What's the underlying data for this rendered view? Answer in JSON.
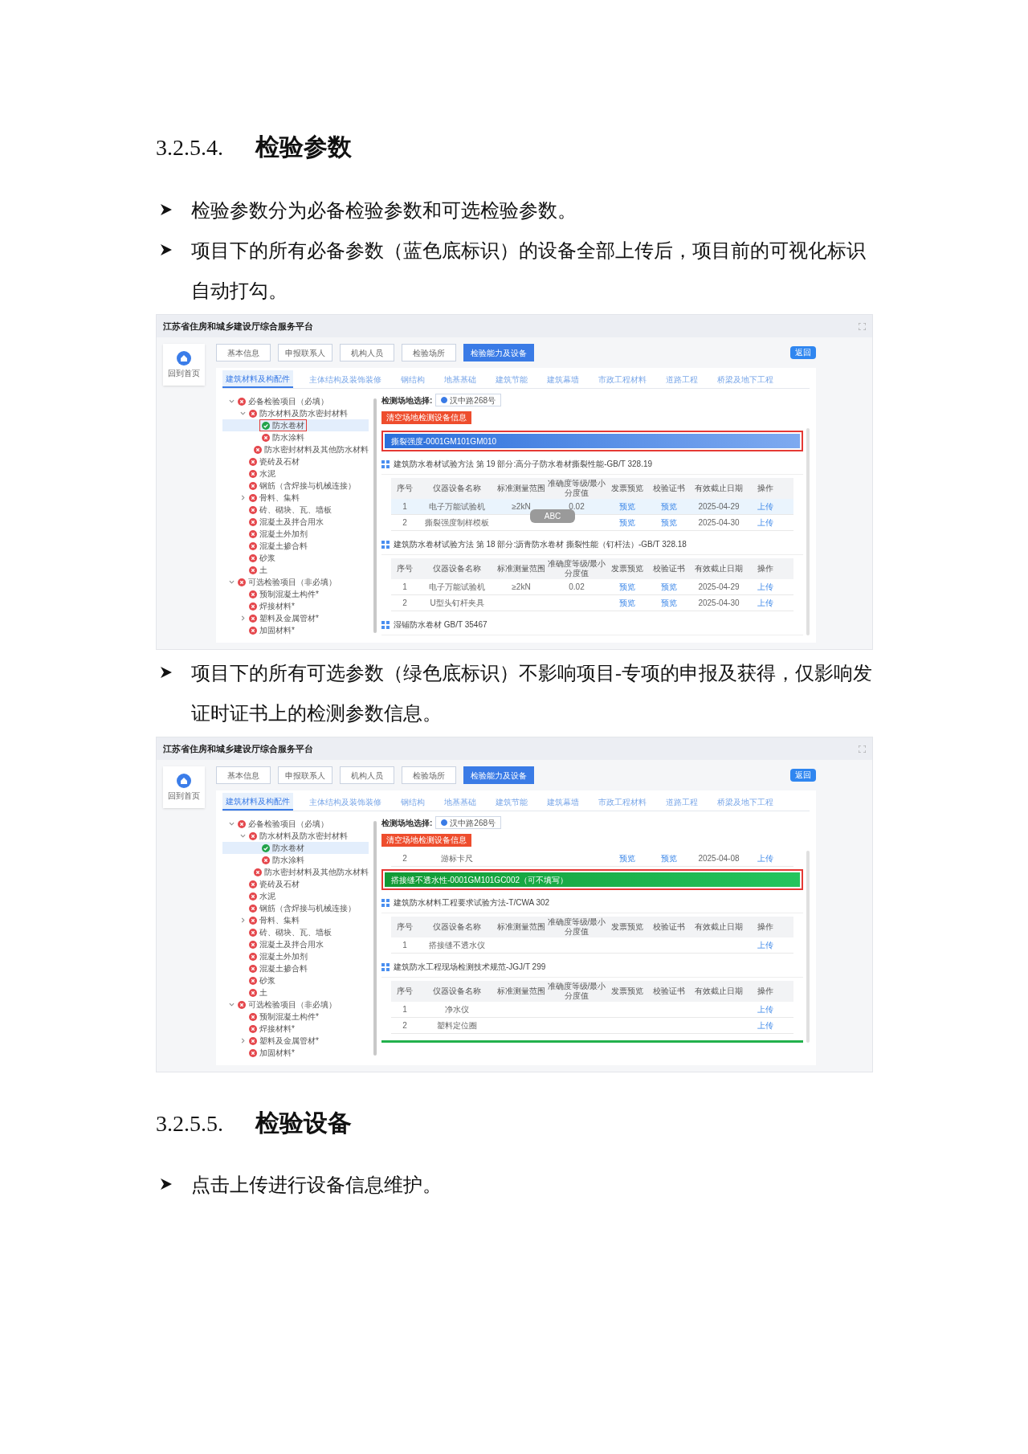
{
  "sections": [
    {
      "kind": "heading",
      "number": "3.2.5.4.",
      "title": "检验参数"
    },
    {
      "kind": "bullet",
      "text": "检验参数分为必备检验参数和可选检验参数。"
    },
    {
      "kind": "bullet",
      "text": "项目下的所有必备参数（蓝色底标识）的设备全部上传后，项目前的可视化标识自动打勾。"
    },
    {
      "kind": "screenshot",
      "platform_title": "江苏省住房和城乡建设厅综合服务平台",
      "home_label": "回到首页",
      "back_button": "返回",
      "nav_buttons": [
        {
          "label": "基本信息",
          "selected": false
        },
        {
          "label": "申报联系人",
          "selected": false
        },
        {
          "label": "机构人员",
          "selected": false
        },
        {
          "label": "检验场所",
          "selected": false
        },
        {
          "label": "检验能力及设备",
          "selected": true
        }
      ],
      "tabs": [
        {
          "label": "建筑材料及构配件",
          "selected": true
        },
        {
          "label": "主体结构及装饰装修",
          "selected": false
        },
        {
          "label": "钢结构",
          "selected": false
        },
        {
          "label": "地基基础",
          "selected": false
        },
        {
          "label": "建筑节能",
          "selected": false
        },
        {
          "label": "建筑幕墙",
          "selected": false
        },
        {
          "label": "市政工程材料",
          "selected": false
        },
        {
          "label": "道路工程",
          "selected": false
        },
        {
          "label": "桥梁及地下工程",
          "selected": false
        }
      ],
      "tree": [
        {
          "label": "必备检验项目（必填）",
          "done": false,
          "selected": false,
          "annotated": false,
          "expanded": true,
          "children": [
            {
              "label": "防水材料及防水密封材料",
              "done": false,
              "selected": false,
              "annotated": false,
              "expanded": true,
              "children": [
                {
                  "label": "防水卷材",
                  "done": true,
                  "selected": true,
                  "annotated": true
                },
                {
                  "label": "防水涂料",
                  "done": false,
                  "selected": false,
                  "annotated": false
                },
                {
                  "label": "防水密封材料及其他防水材料",
                  "done": false,
                  "selected": false,
                  "annotated": false
                }
              ]
            },
            {
              "label": "瓷砖及石材",
              "done": false,
              "selected": false,
              "annotated": false
            },
            {
              "label": "水泥",
              "done": false,
              "selected": false,
              "annotated": false
            },
            {
              "label": "钢筋（含焊接与机械连接）",
              "done": false,
              "selected": false,
              "annotated": false
            },
            {
              "label": "骨料、集料",
              "done": false,
              "selected": false,
              "annotated": false,
              "expanded": false
            },
            {
              "label": "砖、砌块、瓦、墙板",
              "done": false,
              "selected": false,
              "annotated": false
            },
            {
              "label": "混凝土及拌合用水",
              "done": false,
              "selected": false,
              "annotated": false
            },
            {
              "label": "混凝土外加剂",
              "done": false,
              "selected": false,
              "annotated": false
            },
            {
              "label": "混凝土掺合料",
              "done": false,
              "selected": false,
              "annotated": false
            },
            {
              "label": "砂浆",
              "done": false,
              "selected": false,
              "annotated": false
            },
            {
              "label": "土",
              "done": false,
              "selected": false,
              "annotated": false
            }
          ]
        },
        {
          "label": "可选检验项目（非必填）",
          "done": false,
          "selected": false,
          "annotated": false,
          "expanded": true,
          "children": [
            {
              "label": "预制混凝土构件*",
              "done": false,
              "selected": false,
              "annotated": false
            },
            {
              "label": "焊接材料*",
              "done": false,
              "selected": false,
              "annotated": false
            },
            {
              "label": "塑料及金属管材*",
              "done": false,
              "selected": false,
              "annotated": false,
              "expanded": false
            },
            {
              "label": "加固材料*",
              "done": false,
              "selected": false,
              "annotated": false
            }
          ]
        }
      ],
      "site_label": "检测场地选择:",
      "site_options": [
        {
          "label": "汉中路268号",
          "selected": true
        }
      ],
      "clear_button": "清空场地检测设备信息",
      "ime_overlay": {
        "label": "ABC"
      },
      "content": [
        {
          "kind": "param",
          "label": "撕裂强度-0001GM101GM010",
          "optional": false,
          "annotated": true
        },
        {
          "kind": "standard",
          "text": "建筑防水卷材试验方法 第 19 部分:高分子防水卷材撕裂性能-GB/T 328.19"
        },
        {
          "kind": "table",
          "columns": [
            "序号",
            "仪器设备名称",
            "标准测量范围",
            "准确度等级/最小分度值",
            "发票预览",
            "校验证书",
            "有效截止日期",
            "操作"
          ],
          "rows": [
            {
              "highlighted": true,
              "no": "1",
              "name": "电子万能试验机",
              "range": "≥2kN",
              "accuracy": "0.02",
              "invoice": "预览",
              "certificate": "预览",
              "expiry": "2025-04-29",
              "action": "上传"
            },
            {
              "highlighted": false,
              "no": "2",
              "name": "撕裂强度制样模板",
              "invoice": "预览",
              "certificate": "预览",
              "expiry": "2025-04-30",
              "action": "上传"
            }
          ]
        },
        {
          "kind": "standard",
          "text": "建筑防水卷材试验方法 第 18 部分:沥青防水卷材 撕裂性能（钉杆法）-GB/T 328.18"
        },
        {
          "kind": "table",
          "columns": [
            "序号",
            "仪器设备名称",
            "标准测量范围",
            "准确度等级/最小分度值",
            "发票预览",
            "校验证书",
            "有效截止日期",
            "操作"
          ],
          "rows": [
            {
              "highlighted": false,
              "no": "1",
              "name": "电子万能试验机",
              "range": "≥2kN",
              "accuracy": "0.02",
              "invoice": "预览",
              "certificate": "预览",
              "expiry": "2025-04-29",
              "action": "上传"
            },
            {
              "highlighted": false,
              "no": "2",
              "name": "U型头钉杆夹具",
              "invoice": "预览",
              "certificate": "预览",
              "expiry": "2025-04-30",
              "action": "上传"
            }
          ]
        },
        {
          "kind": "standard",
          "text": "湿铺防水卷材 GB/T 35467"
        }
      ]
    },
    {
      "kind": "bullet",
      "text": "项目下的所有可选参数（绿色底标识）不影响项目-专项的申报及获得，仅影响发证时证书上的检测参数信息。"
    },
    {
      "kind": "screenshot",
      "platform_title": "江苏省住房和城乡建设厅综合服务平台",
      "home_label": "回到首页",
      "back_button": "返回",
      "nav_buttons": [
        {
          "label": "基本信息",
          "selected": false
        },
        {
          "label": "申报联系人",
          "selected": false
        },
        {
          "label": "机构人员",
          "selected": false
        },
        {
          "label": "检验场所",
          "selected": false
        },
        {
          "label": "检验能力及设备",
          "selected": true
        }
      ],
      "tabs": [
        {
          "label": "建筑材料及构配件",
          "selected": true
        },
        {
          "label": "主体结构及装饰装修",
          "selected": false
        },
        {
          "label": "钢结构",
          "selected": false
        },
        {
          "label": "地基基础",
          "selected": false
        },
        {
          "label": "建筑节能",
          "selected": false
        },
        {
          "label": "建筑幕墙",
          "selected": false
        },
        {
          "label": "市政工程材料",
          "selected": false
        },
        {
          "label": "道路工程",
          "selected": false
        },
        {
          "label": "桥梁及地下工程",
          "selected": false
        }
      ],
      "tree": [
        {
          "label": "必备检验项目（必填）",
          "done": false,
          "selected": false,
          "annotated": false,
          "expanded": true,
          "children": [
            {
              "label": "防水材料及防水密封材料",
              "done": false,
              "selected": false,
              "annotated": false,
              "expanded": true,
              "children": [
                {
                  "label": "防水卷材",
                  "done": true,
                  "selected": true,
                  "annotated": false
                },
                {
                  "label": "防水涂料",
                  "done": false,
                  "selected": false,
                  "annotated": false
                },
                {
                  "label": "防水密封材料及其他防水材料",
                  "done": false,
                  "selected": false,
                  "annotated": false
                }
              ]
            },
            {
              "label": "瓷砖及石材",
              "done": false,
              "selected": false,
              "annotated": false
            },
            {
              "label": "水泥",
              "done": false,
              "selected": false,
              "annotated": false
            },
            {
              "label": "钢筋（含焊接与机械连接）",
              "done": false,
              "selected": false,
              "annotated": false
            },
            {
              "label": "骨料、集料",
              "done": false,
              "selected": false,
              "annotated": false,
              "expanded": false
            },
            {
              "label": "砖、砌块、瓦、墙板",
              "done": false,
              "selected": false,
              "annotated": false
            },
            {
              "label": "混凝土及拌合用水",
              "done": false,
              "selected": false,
              "annotated": false
            },
            {
              "label": "混凝土外加剂",
              "done": false,
              "selected": false,
              "annotated": false
            },
            {
              "label": "混凝土掺合料",
              "done": false,
              "selected": false,
              "annotated": false
            },
            {
              "label": "砂浆",
              "done": false,
              "selected": false,
              "annotated": false
            },
            {
              "label": "土",
              "done": false,
              "selected": false,
              "annotated": false
            }
          ]
        },
        {
          "label": "可选检验项目（非必填）",
          "done": false,
          "selected": false,
          "annotated": false,
          "expanded": true,
          "children": [
            {
              "label": "预制混凝土构件*",
              "done": false,
              "selected": false,
              "annotated": false
            },
            {
              "label": "焊接材料*",
              "done": false,
              "selected": false,
              "annotated": false
            },
            {
              "label": "塑料及金属管材*",
              "done": false,
              "selected": false,
              "annotated": false,
              "expanded": false
            },
            {
              "label": "加固材料*",
              "done": false,
              "selected": false,
              "annotated": false
            }
          ]
        }
      ],
      "site_label": "检测场地选择:",
      "site_options": [
        {
          "label": "汉中路268号",
          "selected": true
        }
      ],
      "clear_button": "清空场地检测设备信息",
      "content": [
        {
          "kind": "row",
          "row": {
            "highlighted": false,
            "no": "2",
            "name": "游标卡尺",
            "invoice": "预览",
            "certificate": "预览",
            "expiry": "2025-04-08",
            "action": "上传"
          }
        },
        {
          "kind": "param",
          "label": "搭接缝不透水性-0001GM101GC002（可不填写）",
          "optional": true,
          "annotated": true
        },
        {
          "kind": "standard",
          "text": "建筑防水材料工程要求试验方法-T/CWA 302"
        },
        {
          "kind": "table",
          "columns": [
            "序号",
            "仪器设备名称",
            "标准测量范围",
            "准确度等级/最小分度值",
            "发票预览",
            "校验证书",
            "有效截止日期",
            "操作"
          ],
          "rows": [
            {
              "highlighted": false,
              "no": "1",
              "name": "搭接缝不透水仪",
              "action": "上传"
            }
          ]
        },
        {
          "kind": "standard",
          "text": "建筑防水工程现场检测技术规范-JGJ/T 299"
        },
        {
          "kind": "table",
          "columns": [
            "序号",
            "仪器设备名称",
            "标准测量范围",
            "准确度等级/最小分度值",
            "发票预览",
            "校验证书",
            "有效截止日期",
            "操作"
          ],
          "rows": [
            {
              "highlighted": false,
              "no": "1",
              "name": "净水仪",
              "action": "上传"
            },
            {
              "highlighted": false,
              "no": "2",
              "name": "塑料定位圈",
              "action": "上传"
            }
          ]
        },
        {
          "kind": "param_edge",
          "optional": true
        }
      ]
    },
    {
      "kind": "heading",
      "number": "3.2.5.5.",
      "title": "检验设备"
    },
    {
      "kind": "bullet",
      "text": "点击上传进行设备信息维护。"
    }
  ]
}
